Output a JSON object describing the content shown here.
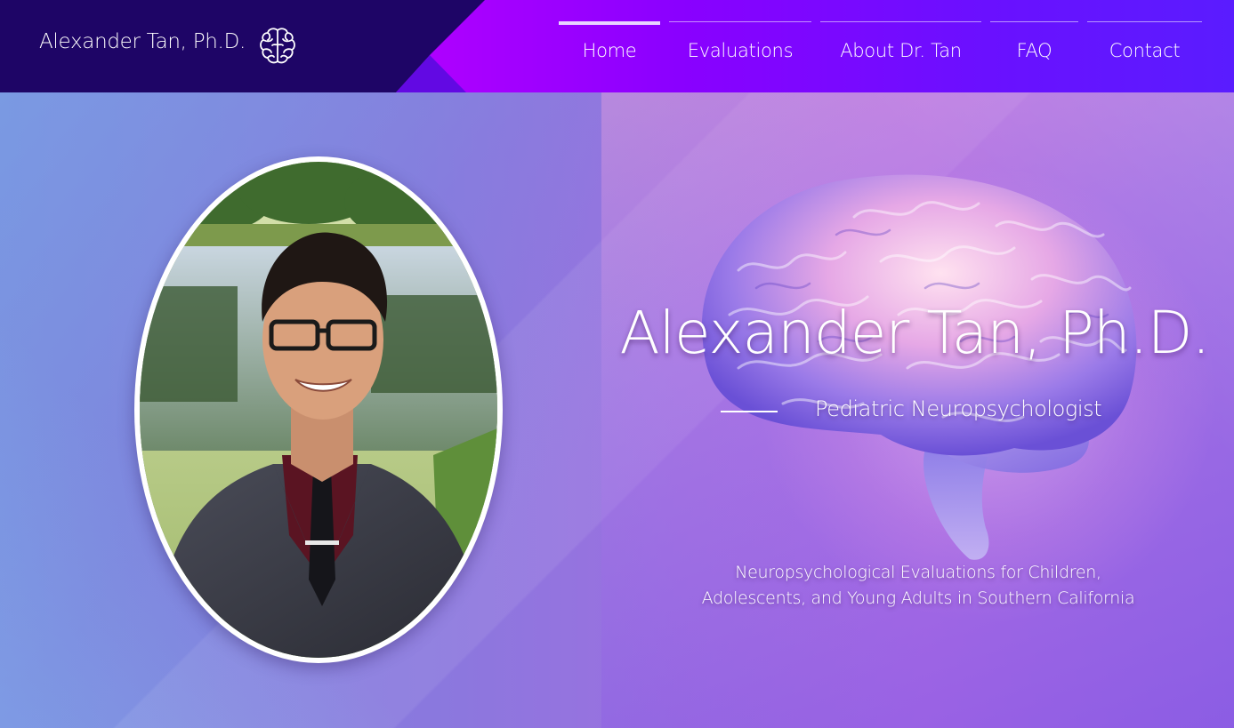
{
  "header": {
    "brand": "Alexander Tan, Ph.D.",
    "logo_icon": "brain-outline-icon",
    "nav": [
      {
        "label": "Home",
        "active": true
      },
      {
        "label": "Evaluations",
        "active": false
      },
      {
        "label": "About Dr. Tan",
        "active": false
      },
      {
        "label": "FAQ",
        "active": false
      },
      {
        "label": "Contact",
        "active": false
      }
    ]
  },
  "hero": {
    "title": "Alexander Tan, Ph.D.",
    "subtitle": "Pediatric Neuropsychologist",
    "description_line1": "Neuropsychological Evaluations for Children,",
    "description_line2": "Adolescents, and Young Adults in Southern California",
    "portrait_icon": "portrait-photo",
    "background_image": "brain-illustration"
  },
  "colors": {
    "header_dark": "#1e0566",
    "header_accent": "#ff00f0",
    "header_end": "#5a1cff",
    "hero_base": "#8a78de",
    "text": "#ffffff"
  }
}
